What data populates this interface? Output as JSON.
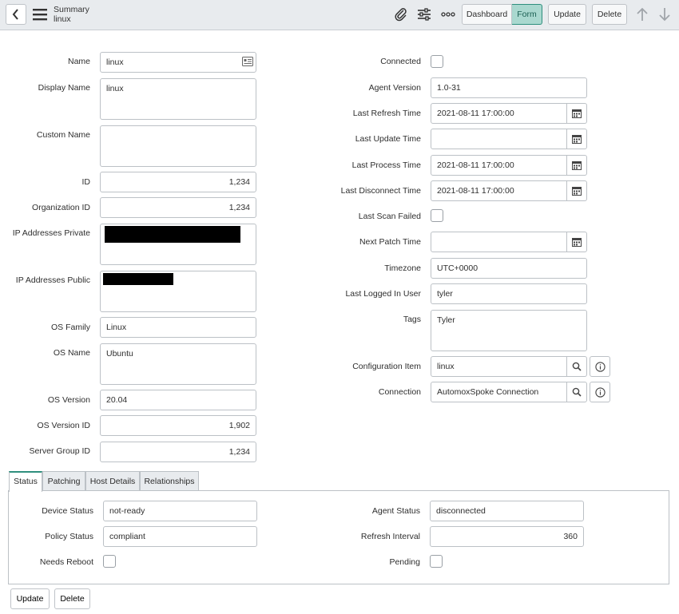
{
  "header": {
    "breadcrumb_title": "Summary",
    "breadcrumb_record": "linux",
    "view_dashboard": "Dashboard",
    "view_form": "Form",
    "update_label": "Update",
    "delete_label": "Delete",
    "icons": [
      "back-icon",
      "hamburger-menu-icon",
      "paperclip-icon",
      "sliders-icon",
      "more-icon",
      "arrow-up-icon",
      "arrow-down-icon"
    ]
  },
  "left": {
    "name": {
      "label": "Name",
      "value": "linux"
    },
    "display_name": {
      "label": "Display Name",
      "value": "linux"
    },
    "custom_name": {
      "label": "Custom Name",
      "value": ""
    },
    "id": {
      "label": "ID",
      "value": "1,234"
    },
    "organization_id": {
      "label": "Organization ID",
      "value": "1,234"
    },
    "ip_private": {
      "label": "IP Addresses Private",
      "value": ""
    },
    "ip_public": {
      "label": "IP Addresses Public",
      "value": ""
    },
    "os_family": {
      "label": "OS Family",
      "value": "Linux"
    },
    "os_name": {
      "label": "OS Name",
      "value": "Ubuntu"
    },
    "os_version": {
      "label": "OS Version",
      "value": "20.04"
    },
    "os_version_id": {
      "label": "OS Version ID",
      "value": "1,902"
    },
    "server_group_id": {
      "label": "Server Group ID",
      "value": "1,234"
    }
  },
  "right": {
    "connected": {
      "label": "Connected",
      "checked": false
    },
    "agent_version": {
      "label": "Agent Version",
      "value": "1.0-31"
    },
    "last_refresh_time": {
      "label": "Last Refresh Time",
      "value": "2021-08-11 17:00:00"
    },
    "last_update_time": {
      "label": "Last Update Time",
      "value": ""
    },
    "last_process_time": {
      "label": "Last Process Time",
      "value": "2021-08-11 17:00:00"
    },
    "last_disconnect_time": {
      "label": "Last Disconnect Time",
      "value": "2021-08-11 17:00:00"
    },
    "last_scan_failed": {
      "label": "Last Scan Failed",
      "checked": false
    },
    "next_patch_time": {
      "label": "Next Patch Time",
      "value": ""
    },
    "timezone": {
      "label": "Timezone",
      "value": "UTC+0000"
    },
    "last_logged_in_user": {
      "label": "Last Logged In User",
      "value": "tyler"
    },
    "tags": {
      "label": "Tags",
      "value": "Tyler"
    },
    "configuration_item": {
      "label": "Configuration Item",
      "value": "linux"
    },
    "connection": {
      "label": "Connection",
      "value": "AutomoxSpoke Connection"
    }
  },
  "tabs": [
    {
      "label": "Status",
      "active": true
    },
    {
      "label": "Patching",
      "active": false
    },
    {
      "label": "Host Details",
      "active": false
    },
    {
      "label": "Relationships",
      "active": false
    }
  ],
  "status_tab": {
    "device_status": {
      "label": "Device Status",
      "value": "not-ready"
    },
    "policy_status": {
      "label": "Policy Status",
      "value": "compliant"
    },
    "needs_reboot": {
      "label": "Needs Reboot",
      "checked": false
    },
    "agent_status": {
      "label": "Agent Status",
      "value": "disconnected"
    },
    "refresh_interval": {
      "label": "Refresh Interval",
      "value": "360"
    },
    "pending": {
      "label": "Pending",
      "checked": false
    }
  },
  "footer": {
    "update_label": "Update",
    "delete_label": "Delete"
  },
  "colors": {
    "accent": "#2f8f7d",
    "active_toggle_bg": "#a9d8cf",
    "header_bg": "#e8ebee",
    "redaction": "#000000"
  }
}
